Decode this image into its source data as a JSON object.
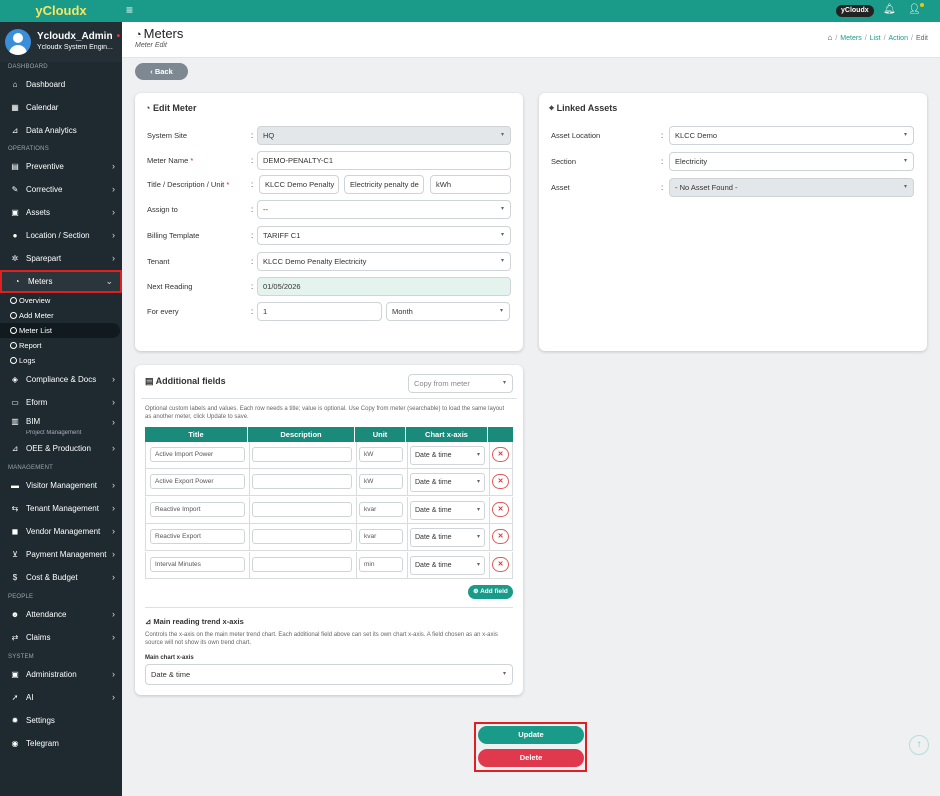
{
  "app": {
    "brand": "yCloudx",
    "top_pill": "yCloudx"
  },
  "profile": {
    "name": "Ycloudx_Admin",
    "role": "Ycloudx System Engin..."
  },
  "sidebar": {
    "sections": {
      "dashboard": "DASHBOARD",
      "operations": "OPERATIONS",
      "management": "MANAGEMENT",
      "people": "PEOPLE",
      "system": "SYSTEM"
    },
    "items": {
      "dashboard": "Dashboard",
      "calendar": "Calendar",
      "analytics": "Data Analytics",
      "preventive": "Preventive",
      "corrective": "Corrective",
      "assets": "Assets",
      "location": "Location / Section",
      "sparepart": "Sparepart",
      "meters": "Meters",
      "compliance": "Compliance & Docs",
      "eform": "Eform",
      "bim": "BIM",
      "project": "Project Management",
      "oee": "OEE & Production",
      "visitor": "Visitor Management",
      "tenant": "Tenant Management",
      "vendor": "Vendor Management",
      "payment": "Payment Management",
      "cost": "Cost & Budget",
      "attendance": "Attendance",
      "claims": "Claims",
      "administration": "Administration",
      "ai": "AI",
      "settings": "Settings",
      "telegram": "Telegram"
    },
    "meters_sub": [
      "Overview",
      "Add Meter",
      "Meter List",
      "Report",
      "Logs"
    ]
  },
  "header": {
    "title": "Meters",
    "subtitle": "Meter Edit",
    "breadcrumb": [
      "Meters",
      "List",
      "Action",
      "Edit"
    ]
  },
  "back_label": "Back",
  "edit_meter": {
    "title": "Edit Meter",
    "labels": {
      "system_site": "System Site",
      "meter_name": "Meter Name",
      "title_desc_unit": "Title / Description / Unit",
      "assign_to": "Assign to",
      "billing_template": "Billing Template",
      "tenant": "Tenant",
      "next_reading": "Next Reading",
      "for_every": "For every"
    },
    "values": {
      "system_site": "HQ",
      "meter_name": "DEMO-PENALTY-C1",
      "title": "KLCC Demo Penalty",
      "description": "Electricity penalty de",
      "unit": "kWh",
      "assign_to": "--",
      "billing_template": "TARIFF C1",
      "tenant": "KLCC Demo Penalty Electricity",
      "next_reading": "01/05/2026",
      "every_count": "1",
      "every_period": "Month"
    }
  },
  "linked_assets": {
    "title": "Linked Assets",
    "labels": {
      "asset_location": "Asset Location",
      "section": "Section",
      "asset": "Asset"
    },
    "values": {
      "asset_location": "KLCC Demo",
      "section": "Electricity",
      "asset": "- No Asset Found -"
    }
  },
  "additional_fields": {
    "title": "Additional fields",
    "copy_placeholder": "Copy from meter",
    "note": "Optional custom labels and values. Each row needs a title; value is optional. Use Copy from meter (searchable) to load the same layout as another meter, click Update to save.",
    "columns": [
      "Title",
      "Description",
      "Unit",
      "Chart x-axis"
    ],
    "rows": [
      {
        "title": "Active Import Power",
        "unit": "kW",
        "axis": "Date & time"
      },
      {
        "title": "Active Export Power",
        "unit": "kW",
        "axis": "Date & time"
      },
      {
        "title": "Reactive Import",
        "unit": "kvar",
        "axis": "Date & time"
      },
      {
        "title": "Reactive Export",
        "unit": "kvar",
        "axis": "Date & time"
      },
      {
        "title": "Interval Minutes",
        "unit": "min",
        "axis": "Date & time"
      }
    ],
    "add_field": "Add field",
    "trend_title": "Main reading trend x-axis",
    "trend_note": "Controls the x-axis on the main meter trend chart. Each additional field above can set its own chart x-axis. A field chosen as an x-axis source will not show its own trend chart.",
    "main_axis_label": "Main chart x-axis",
    "main_axis_value": "Date & time"
  },
  "actions": {
    "update": "Update",
    "delete": "Delete"
  }
}
